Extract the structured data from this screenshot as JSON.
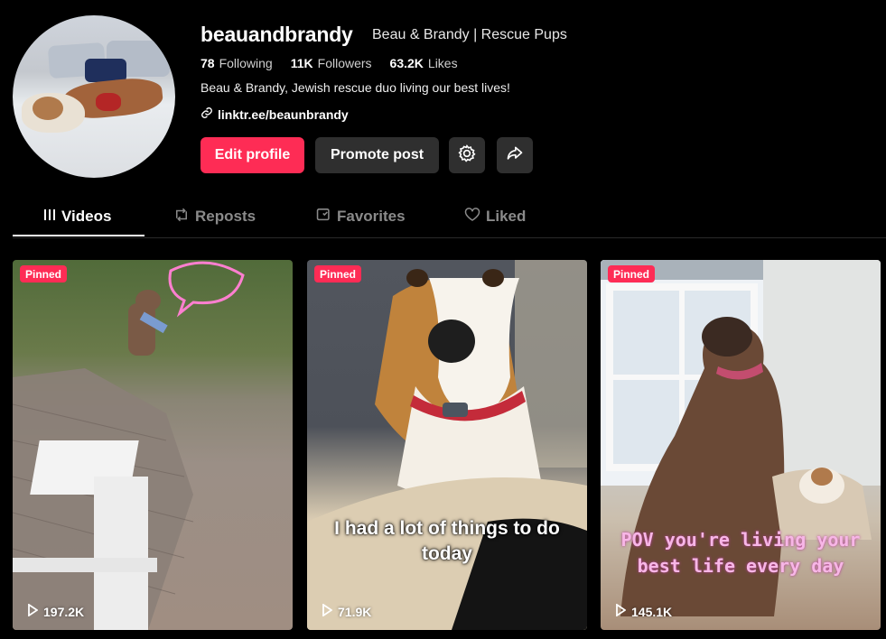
{
  "profile": {
    "username": "beauandbrandy",
    "nickname": "Beau & Brandy | Rescue Pups",
    "stats": [
      {
        "value": "78",
        "label": "Following"
      },
      {
        "value": "11K",
        "label": "Followers"
      },
      {
        "value": "63.2K",
        "label": "Likes"
      }
    ],
    "bio": "Beau & Brandy, Jewish rescue duo living our best lives!",
    "link": "linktr.ee/beaunbrandy"
  },
  "actions": {
    "edit_label": "Edit profile",
    "promote_label": "Promote post",
    "settings_icon": "gear-icon",
    "share_icon": "share-icon"
  },
  "tabs": [
    {
      "label": "Videos",
      "icon": "grid-icon",
      "active": true
    },
    {
      "label": "Reposts",
      "icon": "repost-icon",
      "active": false
    },
    {
      "label": "Favorites",
      "icon": "bookmark-icon",
      "active": false
    },
    {
      "label": "Liked",
      "icon": "heart-icon",
      "active": false
    }
  ],
  "videos": [
    {
      "badge": "Pinned",
      "views": "197.2K",
      "caption": ""
    },
    {
      "badge": "Pinned",
      "views": "71.9K",
      "caption": "I had a lot of things to do today"
    },
    {
      "badge": "Pinned",
      "views": "145.1K",
      "caption": "POV you're living your best life every day"
    }
  ],
  "colors": {
    "accent": "#fe2c55",
    "background": "#000000",
    "button_dark": "#2f2f2f"
  }
}
